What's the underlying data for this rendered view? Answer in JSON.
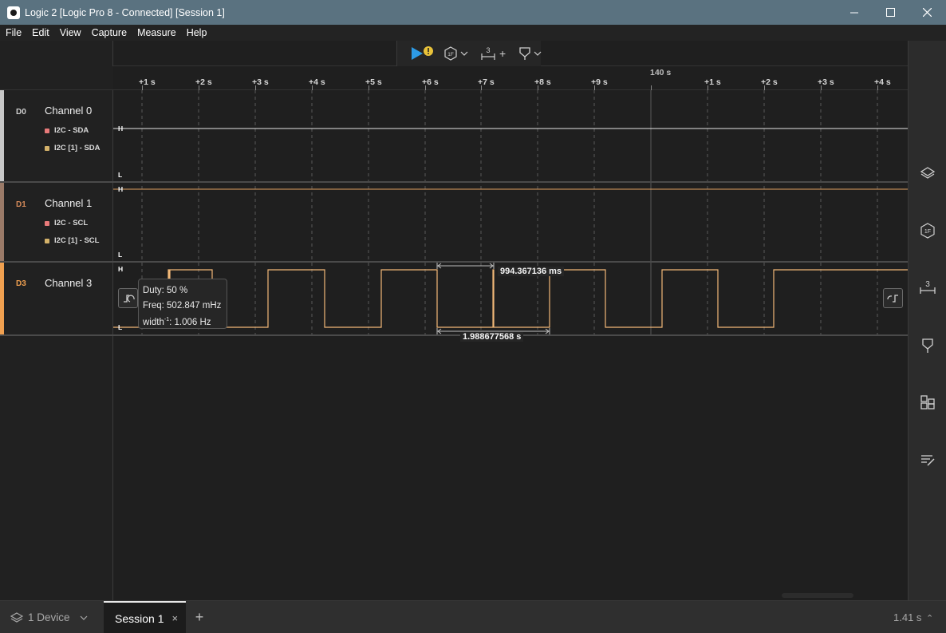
{
  "window": {
    "title": "Logic 2 [Logic Pro 8 - Connected] [Session 1]",
    "minimize_glyph": "—",
    "maximize_glyph": "☐",
    "close_glyph": "✕"
  },
  "menu": [
    "File",
    "Edit",
    "View",
    "Capture",
    "Measure",
    "Help"
  ],
  "toolbar": {
    "start_icon": "play-icon",
    "warning_glyph": "!",
    "analyzer_icon": "hex-1f-icon",
    "measure_icon": "measure-3-icon",
    "measure_plus": "+",
    "marker_icon": "marker-pin-icon",
    "chevron": "⌄"
  },
  "ruler": {
    "major_label": "140 s",
    "ticks": [
      "+1 s",
      "+2 s",
      "+3 s",
      "+4 s",
      "+5 s",
      "+6 s",
      "+7 s",
      "+8 s",
      "+9 s",
      "+1 s",
      "+2 s",
      "+3 s",
      "+4 s"
    ]
  },
  "channels": [
    {
      "id": "D0",
      "name": "Channel 0",
      "color": "#c8c8c8",
      "id_color": "#d0d0d0",
      "analyzers": [
        {
          "label": "I2C - SDA",
          "color": "#e87a7a"
        },
        {
          "label": "I2C [1] - SDA",
          "color": "#d4b26a"
        }
      ],
      "high_label": "H",
      "low_label": "L"
    },
    {
      "id": "D1",
      "name": "Channel 1",
      "color": "#9a7a68",
      "id_color": "#d48a5a",
      "analyzers": [
        {
          "label": "I2C - SCL",
          "color": "#e87a7a"
        },
        {
          "label": "I2C [1] - SCL",
          "color": "#d4b26a"
        }
      ],
      "high_label": "H",
      "low_label": "L"
    },
    {
      "id": "D3",
      "name": "Channel 3",
      "color": "#f0a050",
      "id_color": "#f0a050",
      "analyzers": [],
      "high_label": "H",
      "low_label": "L"
    }
  ],
  "waveform_colors": {
    "d0": "#e6e6e6",
    "d1": "#e0a060",
    "d3": "#f2b878"
  },
  "tooltip": {
    "duty": "Duty: 50 %",
    "freq": "Freq: 502.847 mHz",
    "width_prefix": "width",
    "width_sup": "-1",
    "width_suffix": ": 1.006 Hz"
  },
  "measurements": {
    "pulse_width": "994.367136 ms",
    "period": "1.988677568 s"
  },
  "right_sidebar": [
    "device-layers-icon",
    "analyzers-1f-icon",
    "measurements-3-icon",
    "markers-pin-icon",
    "extensions-grid-icon",
    "notes-icon"
  ],
  "statusbar": {
    "device_label": "1 Device",
    "session_label": "Session 1",
    "close_glyph": "×",
    "add_glyph": "+",
    "zoom": "1.41 s",
    "zoom_caret": "⌃"
  }
}
